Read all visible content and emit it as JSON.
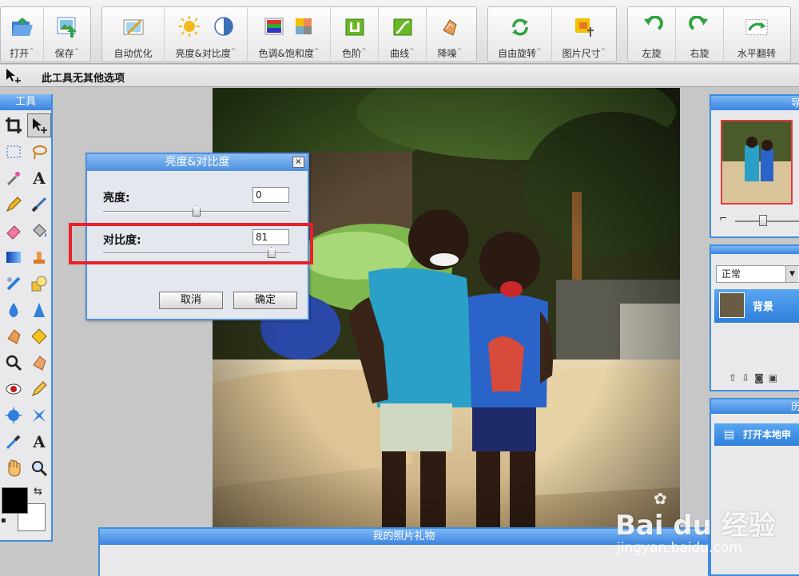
{
  "toolbar": {
    "open": "打开",
    "save": "保存",
    "auto_optimize": "自动优化",
    "brightness_contrast": "亮度&对比度",
    "hue_saturation": "色调&饱和度",
    "levels": "色阶",
    "curves": "曲线",
    "denoise": "降噪",
    "free_rotate": "自由旋转",
    "image_size": "图片尺寸",
    "rotate_left": "左旋",
    "rotate_right": "右旋",
    "flip_horizontal": "水平翻转",
    "arrow_glyph": "^"
  },
  "options_bar": {
    "text": "此工具无其他选项"
  },
  "tools_panel": {
    "title": "工具"
  },
  "dialog": {
    "title": "亮度&对比度",
    "close": "×",
    "brightness_label": "亮度:",
    "brightness_value": "0",
    "contrast_label": "对比度:",
    "contrast_value": "81",
    "cancel": "取消",
    "ok": "确定",
    "brightness_level": 0.5,
    "contrast_level": 0.9
  },
  "navigator_panel": {
    "title": "导"
  },
  "layers_panel": {
    "blend_mode": "正常",
    "layer_name": "背景"
  },
  "history_panel": {
    "title": "历",
    "item": "打开本地申"
  },
  "bottom_panel": {
    "title": "我的照片礼物"
  },
  "watermark": {
    "brand": "Bai du 经验",
    "url": "jingyan.baidu.com"
  },
  "colors": {
    "accent_blue": "#3f8de0",
    "highlight_red": "#e8202a",
    "foreground": "#000000",
    "background": "#ffffff"
  }
}
